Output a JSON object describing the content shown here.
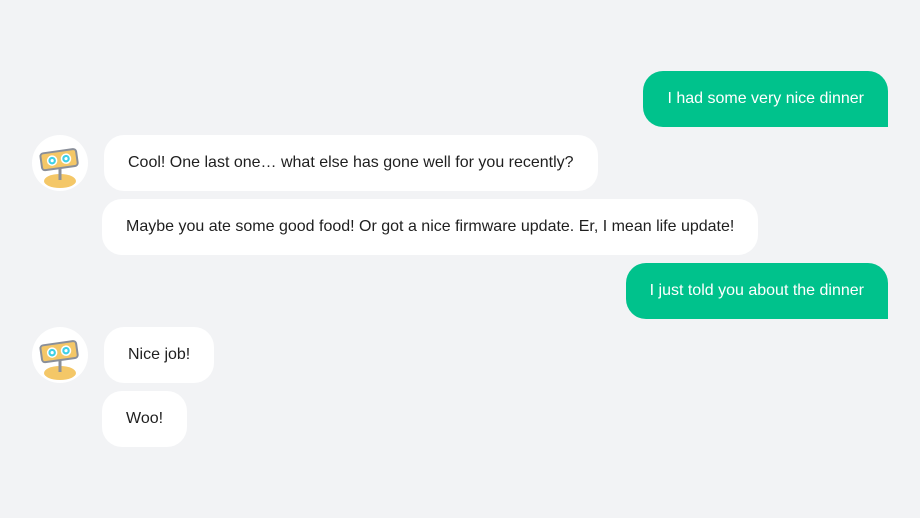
{
  "conversation": {
    "messages": [
      {
        "sender": "user",
        "text": "I had some very nice dinner"
      },
      {
        "sender": "bot",
        "text": "Cool! One last one… what else has gone well for you recently?"
      },
      {
        "sender": "bot",
        "text": "Maybe you ate some good food! Or got a nice firmware update. Er, I mean life update!"
      },
      {
        "sender": "user",
        "text": "I just told you about the dinner"
      },
      {
        "sender": "bot",
        "text": "Nice job!"
      },
      {
        "sender": "bot",
        "text": "Woo!"
      }
    ]
  },
  "colors": {
    "background": "#f2f3f5",
    "user_bubble": "#00c28c",
    "bot_bubble": "#ffffff",
    "bot_text": "#1f1f1f",
    "robot_head": "#f4c767",
    "robot_eyes": "#3fd0e6"
  },
  "icons": {
    "bot_avatar": "robot-icon"
  }
}
